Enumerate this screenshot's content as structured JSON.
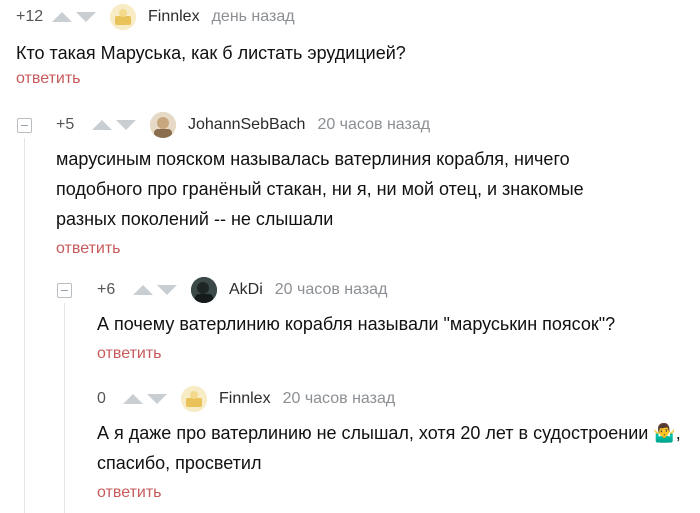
{
  "comments": [
    {
      "score": "+12",
      "username": "Finnlex",
      "time": "день назад",
      "text": "Кто такая Маруська, как б листать эрудицией?",
      "reply": "ответить"
    },
    {
      "score": "+5",
      "username": "JohannSebBach",
      "time": "20 часов назад",
      "text": "марусиным пояском называлась ватерлиния корабля, ничего подобного про гранёный стакан, ни я,  ни мой отец, и знакомые разных поколений -- не слышали",
      "reply": "ответить"
    },
    {
      "score": "+6",
      "username": "AkDi",
      "time": "20 часов назад",
      "text": "А почему ватерлинию корабля называли \"маруськин поясок\"?",
      "reply": "ответить"
    },
    {
      "score": "0",
      "username": "Finnlex",
      "time": "20 часов назад",
      "text": "А я даже про ватерлинию не слышал, хотя 20 лет в судостроении 🤷‍♂️, спасибо, просветил",
      "reply": "ответить"
    }
  ],
  "colors": {
    "reply": "#c75a5a",
    "time": "#8b8f94",
    "vote_arrow": "#c9ced3"
  },
  "icons": {
    "vote_up": "triangle-up",
    "vote_down": "triangle-down",
    "collapse": "minus-square"
  }
}
